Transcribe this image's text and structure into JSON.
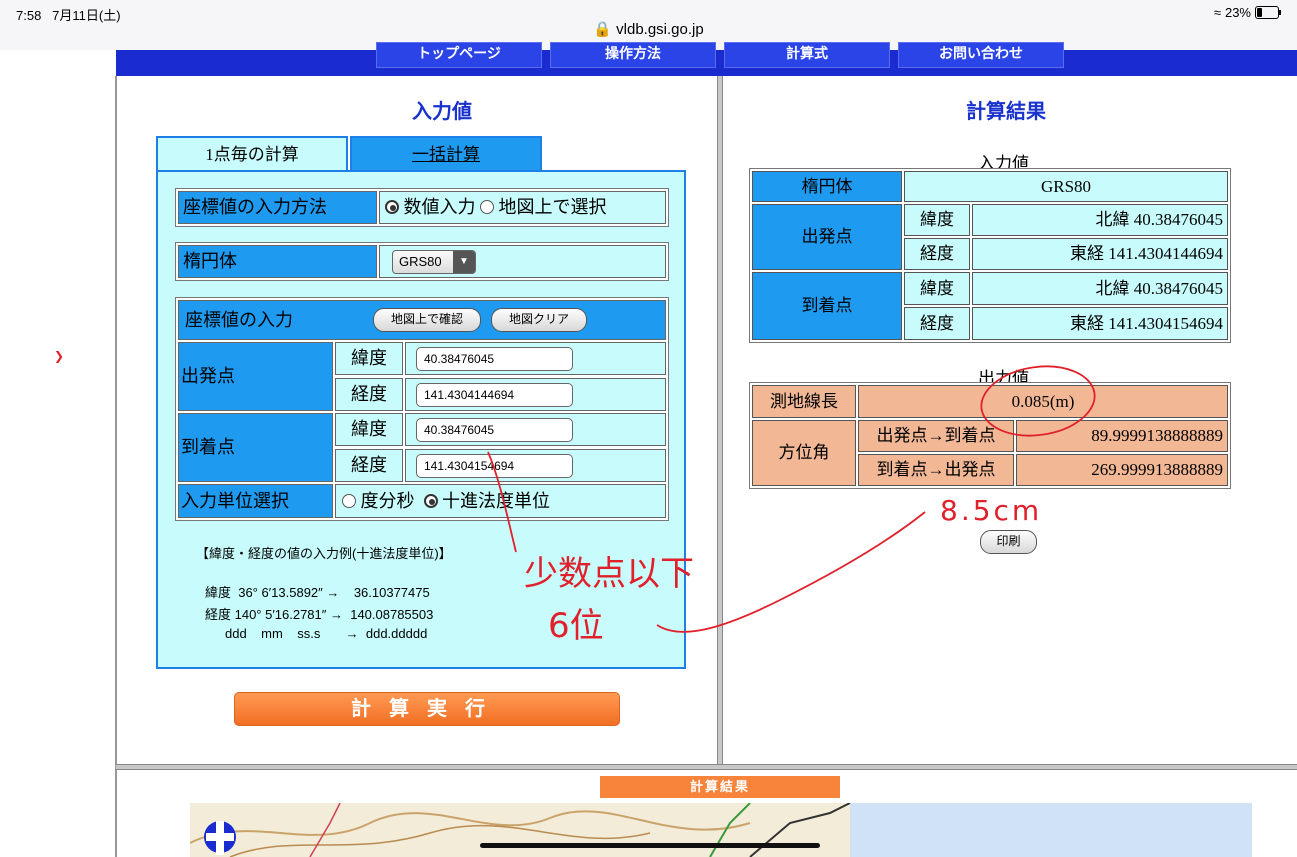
{
  "status_bar": {
    "time": "7:58",
    "date": "7月11日(土)",
    "url": "vldb.gsi.go.jp",
    "battery": "23%"
  },
  "nav": {
    "tabs": [
      "トップページ",
      "操作方法",
      "計算式",
      "お問い合わせ"
    ]
  },
  "input": {
    "title": "入力値",
    "tabs": {
      "single": "1点毎の計算",
      "batch": "一括計算"
    },
    "method": {
      "label": "座標値の入力方法",
      "option_numeric": "数値入力",
      "option_map": "地図上で選択",
      "selected": "数値入力"
    },
    "ellipsoid": {
      "label": "楕円体",
      "value": "GRS80"
    },
    "coords": {
      "header": "座標値の入力",
      "map_confirm_button": "地図上で確認",
      "map_clear_button": "地図クリア",
      "start_label": "出発点",
      "end_label": "到着点",
      "lat_label": "緯度",
      "lon_label": "経度",
      "start_lat": "40.38476045",
      "start_lon": "141.4304144694",
      "end_lat": "40.38476045",
      "end_lon": "141.4304154694"
    },
    "unit": {
      "label": "入力単位選択",
      "option_dms": "度分秒",
      "option_decimal": "十進法度単位",
      "selected": "十進法度単位"
    },
    "example": {
      "title": "【緯度・経度の値の入力例(十進法度単位)】",
      "line1": "緯度  36° 6′13.5892″ →    36.10377475",
      "line2": "経度 140° 5′16.2781″ →  140.08785503",
      "line3": "ddd    mm    ss.s       →  ddd.ddddd"
    },
    "calc_button": "計算実行"
  },
  "result": {
    "title": "計算結果",
    "input_title": "入力値",
    "ellipsoid_label": "楕円体",
    "ellipsoid_value": "GRS80",
    "start_label": "出発点",
    "end_label": "到着点",
    "lat_label": "緯度",
    "lon_label": "経度",
    "start_lat": "北緯 40.38476045",
    "start_lon": "東経 141.4304144694",
    "end_lat": "北緯 40.38476045",
    "end_lon": "東経 141.4304154694",
    "output_title": "出力値",
    "geodesic_label": "測地線長",
    "geodesic_value": "0.085(m)",
    "azimuth_label": "方位角",
    "az_forward_label": "出発点→到着点",
    "az_forward_value": "89.9999138888889",
    "az_back_label": "到着点→出発点",
    "az_back_value": "269.999913888889",
    "print_button": "印刷"
  },
  "map": {
    "banner": "計算結果"
  },
  "annotations": {
    "note_digits_line1": "少数点以下",
    "note_digits_line2": "6位",
    "note_distance": "8.5cm"
  },
  "colors": {
    "nav": "#1a2bcf",
    "cell_blue": "#1e9af0",
    "cell_cyan": "#c8fcfc",
    "cell_orange": "#f2b896",
    "button_orange": "#f26f22",
    "title_blue": "#1a33cc",
    "annotation_red": "#e0202a"
  }
}
